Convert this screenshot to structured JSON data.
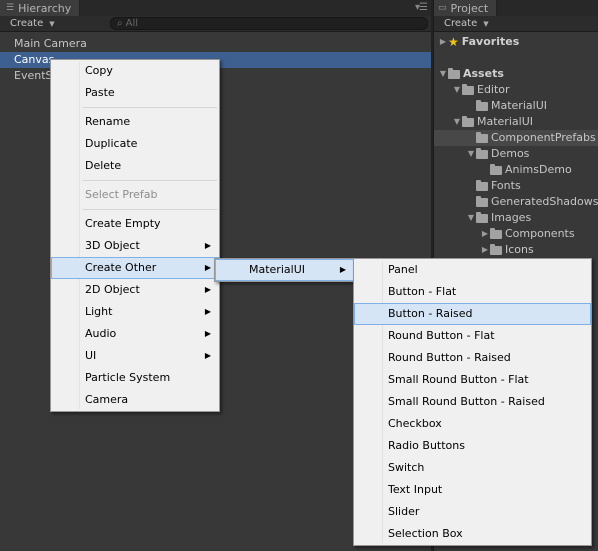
{
  "hierarchy": {
    "tab_title": "Hierarchy",
    "create_label": "Create",
    "search_placeholder": "All",
    "rows": [
      "Main Camera",
      "Canvas",
      "EventSystem"
    ]
  },
  "project": {
    "tab_title": "Project",
    "create_label": "Create",
    "items": [
      {
        "label": "Favorites",
        "depth": 0,
        "arrow": "▶",
        "icon": "star-icon"
      },
      {
        "label": "",
        "depth": 0,
        "arrow": "",
        "icon": ""
      },
      {
        "label": "Assets",
        "depth": 0,
        "arrow": "▼",
        "icon": "folder-icon"
      },
      {
        "label": "Editor",
        "depth": 1,
        "arrow": "▼",
        "icon": "folder-icon"
      },
      {
        "label": "MaterialUI",
        "depth": 2,
        "arrow": "",
        "icon": "folder-icon"
      },
      {
        "label": "MaterialUI",
        "depth": 1,
        "arrow": "▼",
        "icon": "folder-icon"
      },
      {
        "label": "ComponentPrefabs",
        "depth": 2,
        "arrow": "",
        "icon": "folder-icon"
      },
      {
        "label": "Demos",
        "depth": 2,
        "arrow": "▼",
        "icon": "folder-icon"
      },
      {
        "label": "AnimsDemo",
        "depth": 3,
        "arrow": "",
        "icon": "folder-icon"
      },
      {
        "label": "Fonts",
        "depth": 2,
        "arrow": "",
        "icon": "folder-icon"
      },
      {
        "label": "GeneratedShadows",
        "depth": 2,
        "arrow": "",
        "icon": "folder-icon"
      },
      {
        "label": "Images",
        "depth": 2,
        "arrow": "▼",
        "icon": "folder-icon"
      },
      {
        "label": "Components",
        "depth": 3,
        "arrow": "▶",
        "icon": "folder-icon"
      },
      {
        "label": "Icons",
        "depth": 3,
        "arrow": "▶",
        "icon": "folder-icon"
      }
    ]
  },
  "context_menu": {
    "copy": "Copy",
    "paste": "Paste",
    "rename": "Rename",
    "duplicate": "Duplicate",
    "delete": "Delete",
    "select_prefab": "Select Prefab",
    "create_empty": "Create Empty",
    "object_3d": "3D Object",
    "create_other": "Create Other",
    "object_2d": "2D Object",
    "light": "Light",
    "audio": "Audio",
    "ui": "UI",
    "particle_system": "Particle System",
    "camera": "Camera"
  },
  "submenu_create_other": {
    "materialui": "MaterialUI"
  },
  "submenu_materialui": {
    "items": [
      "Panel",
      "Button - Flat",
      "Button - Raised",
      "Round Button - Flat",
      "Round Button - Raised",
      "Small Round Button - Flat",
      "Small Round Button - Raised",
      "Checkbox",
      "Radio Buttons",
      "Switch",
      "Text Input",
      "Slider",
      "Selection Box"
    ],
    "highlighted": "Button - Raised"
  },
  "colors": {
    "panel_bg": "#383838",
    "selection_blue": "#3d6090",
    "menu_bg": "#f0f0f0",
    "menu_highlight": "#d6e5f5",
    "star": "#f2c318"
  }
}
